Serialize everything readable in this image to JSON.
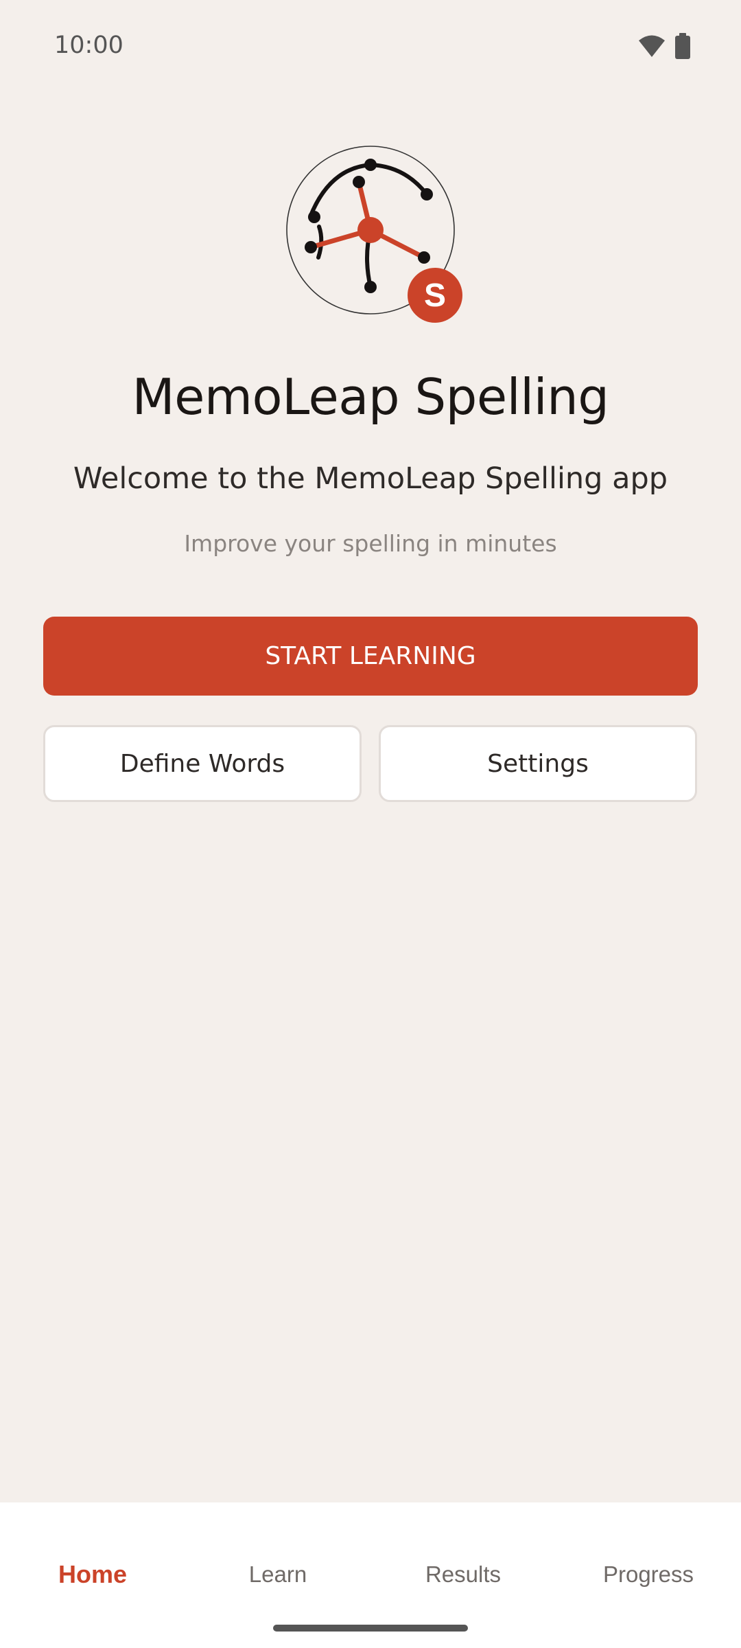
{
  "status_bar": {
    "time": "10:00",
    "icons": [
      "wifi-icon",
      "battery-icon"
    ]
  },
  "logo": {
    "badge_letter": "S",
    "icon": "memory-network-icon"
  },
  "header": {
    "title": "MemoLeap Spelling",
    "welcome": "Welcome to the MemoLeap Spelling app",
    "tagline": "Improve your spelling in minutes"
  },
  "actions": {
    "start_label": "START LEARNING",
    "define_label": "Define Words",
    "settings_label": "Settings"
  },
  "bottom_nav": {
    "items": [
      {
        "label": "Home",
        "active": true
      },
      {
        "label": "Learn",
        "active": false
      },
      {
        "label": "Results",
        "active": false
      },
      {
        "label": "Progress",
        "active": false
      }
    ]
  },
  "colors": {
    "accent": "#cb4329",
    "background": "#f4efeb",
    "text": "#1a1614"
  }
}
